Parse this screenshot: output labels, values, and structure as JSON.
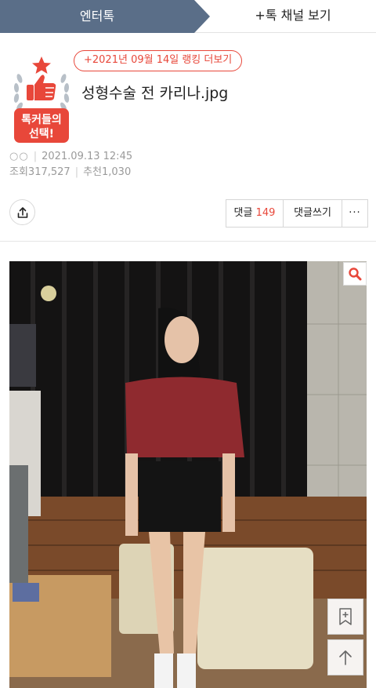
{
  "tabs": {
    "active": "엔터톡",
    "channel": "+톡 채널 보기"
  },
  "badge": {
    "line1": "톡커들의",
    "line2": "선택!"
  },
  "ranking_link": "+2021년 09월 14일 랭킹 더보기",
  "post": {
    "title": "성형수술 전 카리나.jpg",
    "author": "○○",
    "date": "2021.09.13 12:45",
    "views_label": "조회317,527",
    "recommend_label": "추천1,030"
  },
  "actions": {
    "comment_label": "댓글",
    "comment_count": "149",
    "write_label": "댓글쓰기",
    "more_label": "···"
  },
  "icons": {
    "share": "share-icon",
    "zoom": "magnifier-icon",
    "bookmark": "bookmark-add-icon",
    "scroll_top": "arrow-up-icon"
  },
  "colors": {
    "tab_active_bg": "#5a6e88",
    "accent_red": "#e8473a"
  }
}
